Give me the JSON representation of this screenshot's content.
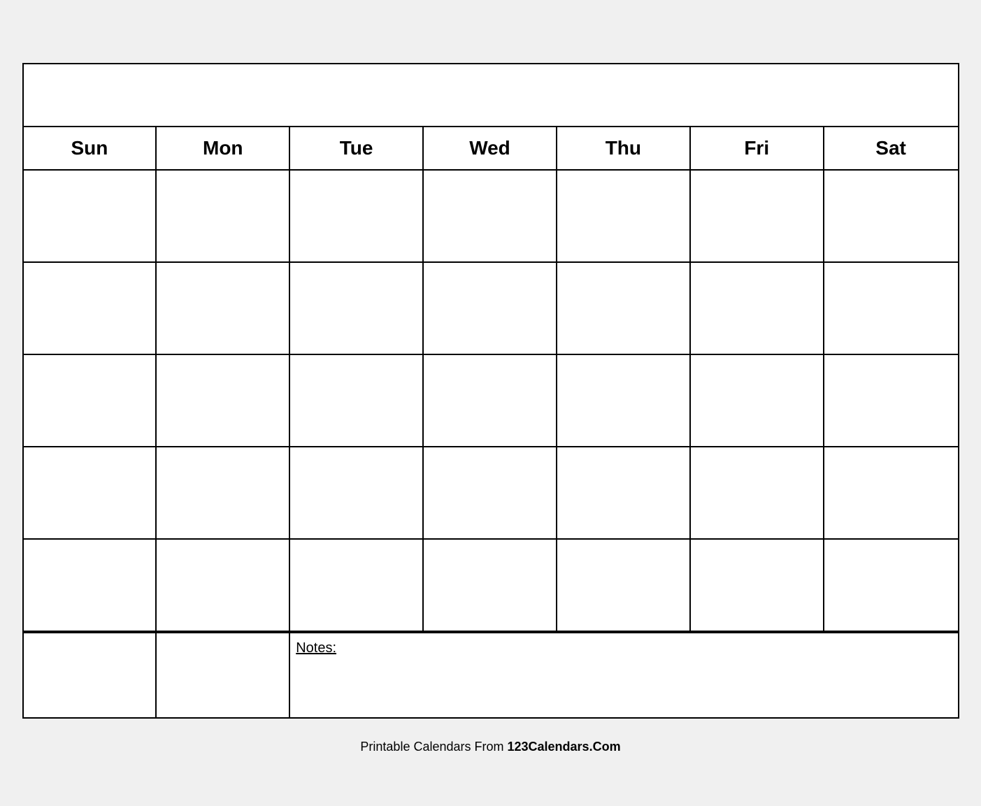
{
  "calendar": {
    "title": "",
    "days": [
      "Sun",
      "Mon",
      "Tue",
      "Wed",
      "Thu",
      "Fri",
      "Sat"
    ],
    "rows": 5,
    "notes_label": "Notes:"
  },
  "footer": {
    "text_normal": "Printable Calendars From ",
    "text_bold": "123Calendars.Com"
  }
}
